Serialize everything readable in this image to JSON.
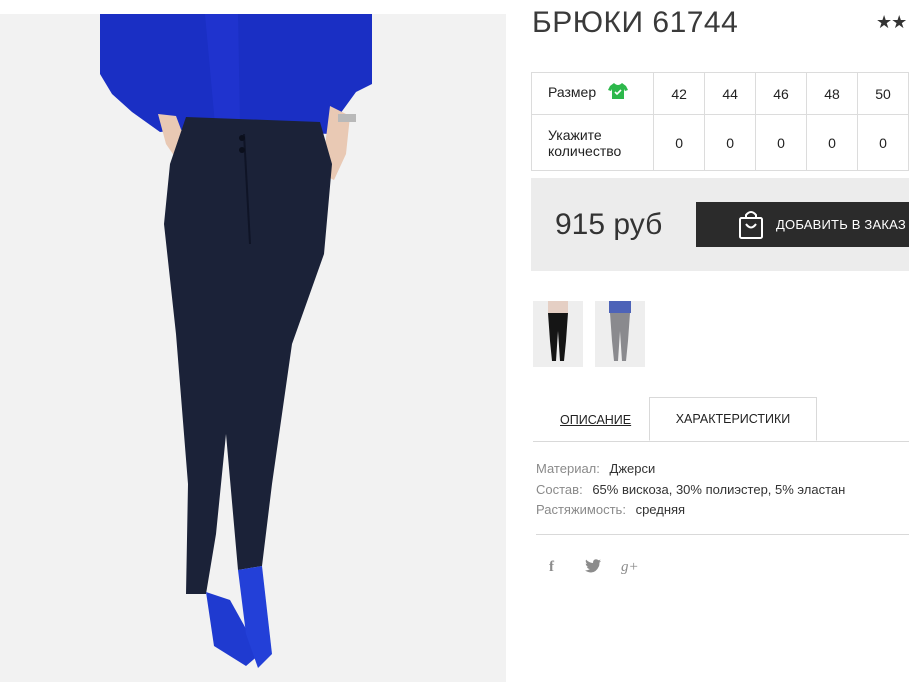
{
  "product": {
    "title": "БРЮКИ 61744",
    "rating": "★★",
    "price": "915 руб"
  },
  "size_table": {
    "size_label": "Размер",
    "qty_label_line1": "Укажите",
    "qty_label_line2": "количество",
    "sizes": [
      "42",
      "44",
      "46",
      "48",
      "50"
    ],
    "quantities": [
      "0",
      "0",
      "0",
      "0",
      "0"
    ]
  },
  "cart": {
    "add_label": "ДОБАВИТЬ В ЗАКАЗ"
  },
  "tabs": {
    "description": "ОПИСАНИЕ",
    "characteristics": "ХАРАКТЕРИСТИКИ",
    "active": "characteristics"
  },
  "properties": [
    {
      "label": "Материал:",
      "value": "Джерси"
    },
    {
      "label": "Состав:",
      "value": "65% вискоза, 30% полиэстер, 5% эластан"
    },
    {
      "label": "Растяжимость:",
      "value": "средняя"
    }
  ],
  "social": {
    "facebook": "f",
    "twitter": "t",
    "googleplus": "g+"
  },
  "icons": [
    "shirt-icon",
    "shopping-bag-icon",
    "facebook-icon",
    "twitter-icon",
    "google-plus-icon"
  ],
  "colors": {
    "dark": "#2b2b2b",
    "panel": "#ececec",
    "accent_green": "#2db84b",
    "shirt_blue": "#1a2fc4",
    "pants_navy": "#1b2238"
  }
}
